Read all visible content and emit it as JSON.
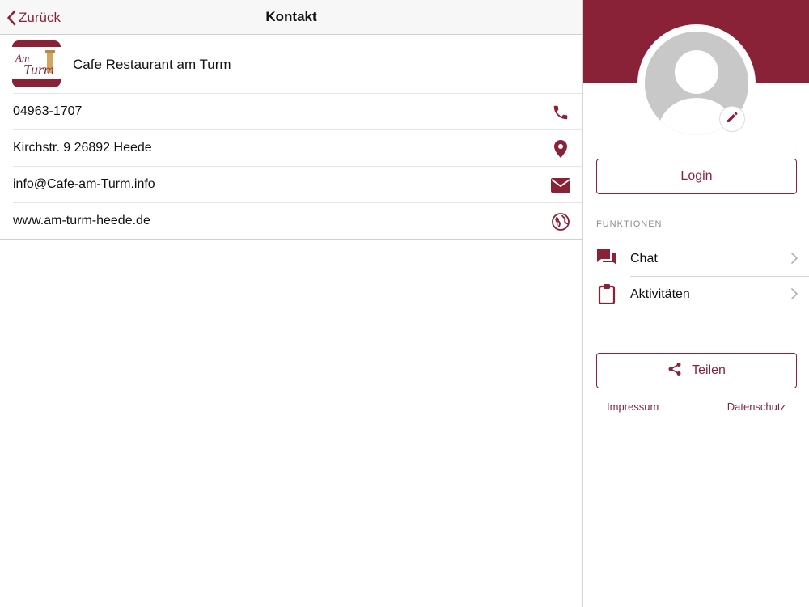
{
  "colors": {
    "accent": "#8a2237",
    "text": "#111111",
    "muted": "#8d8d8d",
    "divider": "#d6d6d6",
    "avatar_bg": "#c8c8c8"
  },
  "navbar": {
    "back_label": "Zurück",
    "title": "Kontakt",
    "back_icon": "chevron-left-icon"
  },
  "business": {
    "name": "Cafe Restaurant am Turm",
    "logo_text_1": "Am",
    "logo_text_2": "Turm"
  },
  "contacts": [
    {
      "text": "04963-1707",
      "icon": "phone-icon"
    },
    {
      "text": "Kirchstr. 9 26892 Heede",
      "icon": "map-pin-icon"
    },
    {
      "text": "info@Cafe-am-Turm.info",
      "icon": "envelope-icon"
    },
    {
      "text": "www.am-turm-heede.de",
      "icon": "globe-icon"
    }
  ],
  "sidebar": {
    "avatar_icon": "user-placeholder-icon",
    "edit_icon": "pencil-icon",
    "login_label": "Login",
    "section_label": "FUNKTIONEN",
    "menu": [
      {
        "label": "Chat",
        "icon": "chat-bubbles-icon"
      },
      {
        "label": "Aktivitäten",
        "icon": "clipboard-icon"
      }
    ],
    "share_label": "Teilen",
    "share_icon": "share-icon",
    "impressum_label": "Impressum",
    "datenschutz_label": "Datenschutz"
  }
}
